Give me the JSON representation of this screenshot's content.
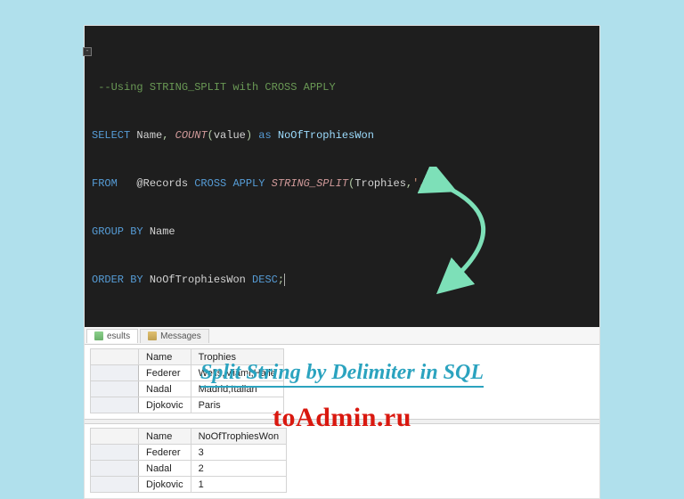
{
  "code": {
    "comment": "--Using STRING_SPLIT with CROSS APPLY",
    "select_kw": "SELECT",
    "select_cols": " Name",
    "comma1": ",",
    "count_fn": " COUNT",
    "count_open": "(",
    "count_arg": "value",
    "count_close": ")",
    "as_kw": " as",
    "alias": " NoOfTrophiesWon",
    "from_kw": "FROM",
    "from_src": "   @Records ",
    "cross_kw": "CROSS",
    "apply_kw": " APPLY",
    "split_fn": " STRING_SPLIT",
    "split_open": "(",
    "split_arg1": "Trophies",
    "split_comma": ",",
    "split_arg2": "','",
    "split_close": ")",
    "group_kw": "GROUP",
    "by1": " BY",
    "group_col": " Name",
    "order_kw": "ORDER",
    "by2": " BY",
    "order_col": " NoOfTrophiesWon ",
    "desc_kw": "DESC",
    "semi": ";"
  },
  "tabs": {
    "results": "esults",
    "messages": "Messages"
  },
  "table1": {
    "headers": [
      "Name",
      "Trophies"
    ],
    "rows": [
      [
        "Federer",
        "Wells,Miami,Halle"
      ],
      [
        "Nadal",
        "Madrid,Italian"
      ],
      [
        "Djokovic",
        "Paris"
      ]
    ]
  },
  "table2": {
    "headers": [
      "Name",
      "NoOfTrophiesWon"
    ],
    "rows": [
      [
        "Federer",
        "3"
      ],
      [
        "Nadal",
        "2"
      ],
      [
        "Djokovic",
        "1"
      ]
    ]
  },
  "title": "Split String by Delimiter in SQL",
  "watermark": "toAdmin.ru"
}
